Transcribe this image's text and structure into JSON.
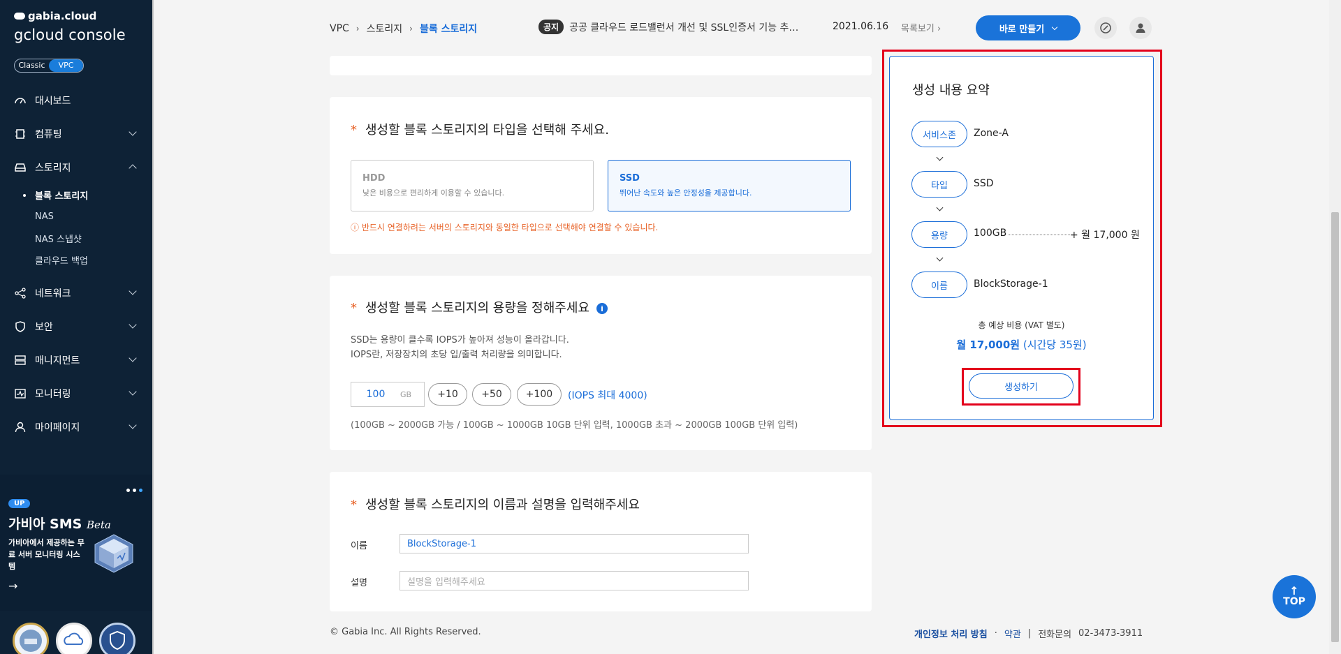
{
  "sidebar": {
    "brand_small": "gabia.cloud",
    "brand_main": "gcloud console",
    "mode": {
      "classic": "Classic",
      "vpc": "VPC"
    },
    "items": [
      {
        "label": "대시보드",
        "icon": "dashboard-icon"
      },
      {
        "label": "컴퓨팅",
        "icon": "chip-icon"
      },
      {
        "label": "스토리지",
        "icon": "storage-icon"
      },
      {
        "label": "네트워크",
        "icon": "network-icon"
      },
      {
        "label": "보안",
        "icon": "shield-icon"
      },
      {
        "label": "매니지먼트",
        "icon": "management-icon"
      },
      {
        "label": "모니터링",
        "icon": "monitor-icon"
      },
      {
        "label": "마이페이지",
        "icon": "user-icon"
      }
    ],
    "storage_sub": [
      "블록 스토리지",
      "NAS",
      "NAS 스냅샷",
      "클라우드 백업"
    ]
  },
  "promo": {
    "badge": "UP",
    "title": "가비아 SMS",
    "title_beta": "Beta",
    "desc": "가비아에서 제공하는 무료 서버 모니터링 시스템",
    "arrow": "→"
  },
  "header": {
    "breadcrumb": [
      "VPC",
      "스토리지",
      "블록 스토리지"
    ],
    "breadcrumb_sep": "›",
    "notice_tag": "공지",
    "notice_text": "공공 클라우드 로드밸런서 개선 및 SSL인증서 기능 추…",
    "notice_date": "2021.06.16",
    "notice_more": "목록보기 ›",
    "create_label": "바로 만들기"
  },
  "type_section": {
    "title": "생성할 블록 스토리지의 타입을 선택해 주세요.",
    "options": [
      {
        "name": "HDD",
        "desc": "낮은 비용으로 편리하게 이용할 수 있습니다."
      },
      {
        "name": "SSD",
        "desc": "뛰어난 속도와 높은 안정성을 제공합니다."
      }
    ],
    "warning": "ⓘ 반드시 연결하려는 서버의 스토리지와 동일한 타입으로 선택해야 연결할 수 있습니다."
  },
  "capacity_section": {
    "title": "생성할 블록 스토리지의 용량을 정해주세요",
    "info": "i",
    "desc1": "SSD는 용량이 클수록 IOPS가 높아져 성능이 올라갑니다.",
    "desc2": "IOPS란, 저장장치의 초당 입/출력 처리량을 의미합니다.",
    "value": "100",
    "unit": "GB",
    "increments": [
      "+10",
      "+50",
      "+100"
    ],
    "iops": "(IOPS 최대 4000)",
    "range": "(100GB ~ 2000GB 가능 / 100GB ~ 1000GB 10GB 단위 입력, 1000GB 초과 ~ 2000GB 100GB 단위 입력)"
  },
  "name_section": {
    "title": "생성할 블록 스토리지의 이름과 설명을 입력해주세요",
    "name_label": "이름",
    "name_value": "BlockStorage-1",
    "desc_label": "설명",
    "desc_placeholder": "설명을 입력해주세요"
  },
  "required_mark": "*",
  "footer": {
    "copy": "© Gabia Inc. All Rights Reserved.",
    "privacy": "개인정보 처리 방침",
    "dot": "·",
    "terms": "약관",
    "bar": "|",
    "contact_label": "전화문의",
    "contact_num": "02-3473-3911"
  },
  "summary": {
    "title": "생성 내용 요약",
    "steps": [
      {
        "label": "서비스존",
        "value": "Zone-A"
      },
      {
        "label": "타입",
        "value": "SSD"
      },
      {
        "label": "용량",
        "value": "100GB"
      },
      {
        "label": "이름",
        "value": "BlockStorage-1"
      }
    ],
    "price": "+ 월 17,000 원",
    "total_label": "총 예상 비용 (VAT 별도)",
    "total_main": "월 17,000원",
    "total_hourly": "(시간당 35원)",
    "submit": "생성하기"
  },
  "top_button": {
    "arrow": "↑",
    "label": "TOP"
  },
  "colors": {
    "accent": "#1a73d9",
    "sidebar": "#0e2236",
    "warning": "#e8652b",
    "highlight": "#e3001b"
  }
}
